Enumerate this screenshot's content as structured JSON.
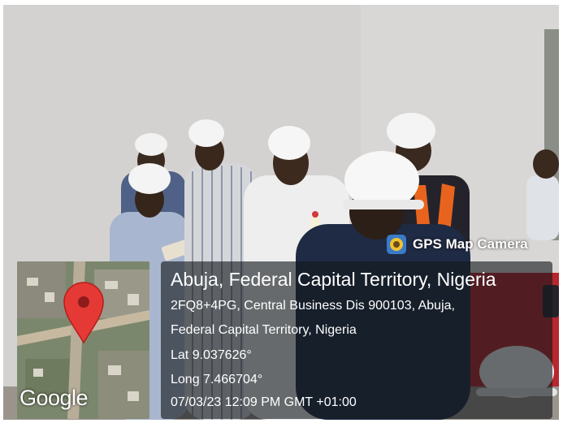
{
  "gps_overlay": {
    "brand_label": "GPS Map Camera",
    "location_title": "Abuja, Federal Capital Territory, Nigeria",
    "address_line_1": "2FQ8+4PG, Central Business Dis 900103, Abuja,",
    "address_line_2": "Federal Capital Territory, Nigeria",
    "latitude": "Lat 9.037626°",
    "longitude": "Long 7.466704°",
    "timestamp": "07/03/23 12:09 PM GMT +01:00",
    "map_logo": "Google"
  },
  "colors": {
    "wall": "#d5d3d1",
    "helmet": "#f4f4f4",
    "overlay_panel": "#14181c",
    "map_pin": "#e53935",
    "brand_icon": "#3a7ac9",
    "safety_vest": "#e8641e"
  },
  "icons": [
    "gps-map-camera-icon",
    "map-pin-icon"
  ]
}
